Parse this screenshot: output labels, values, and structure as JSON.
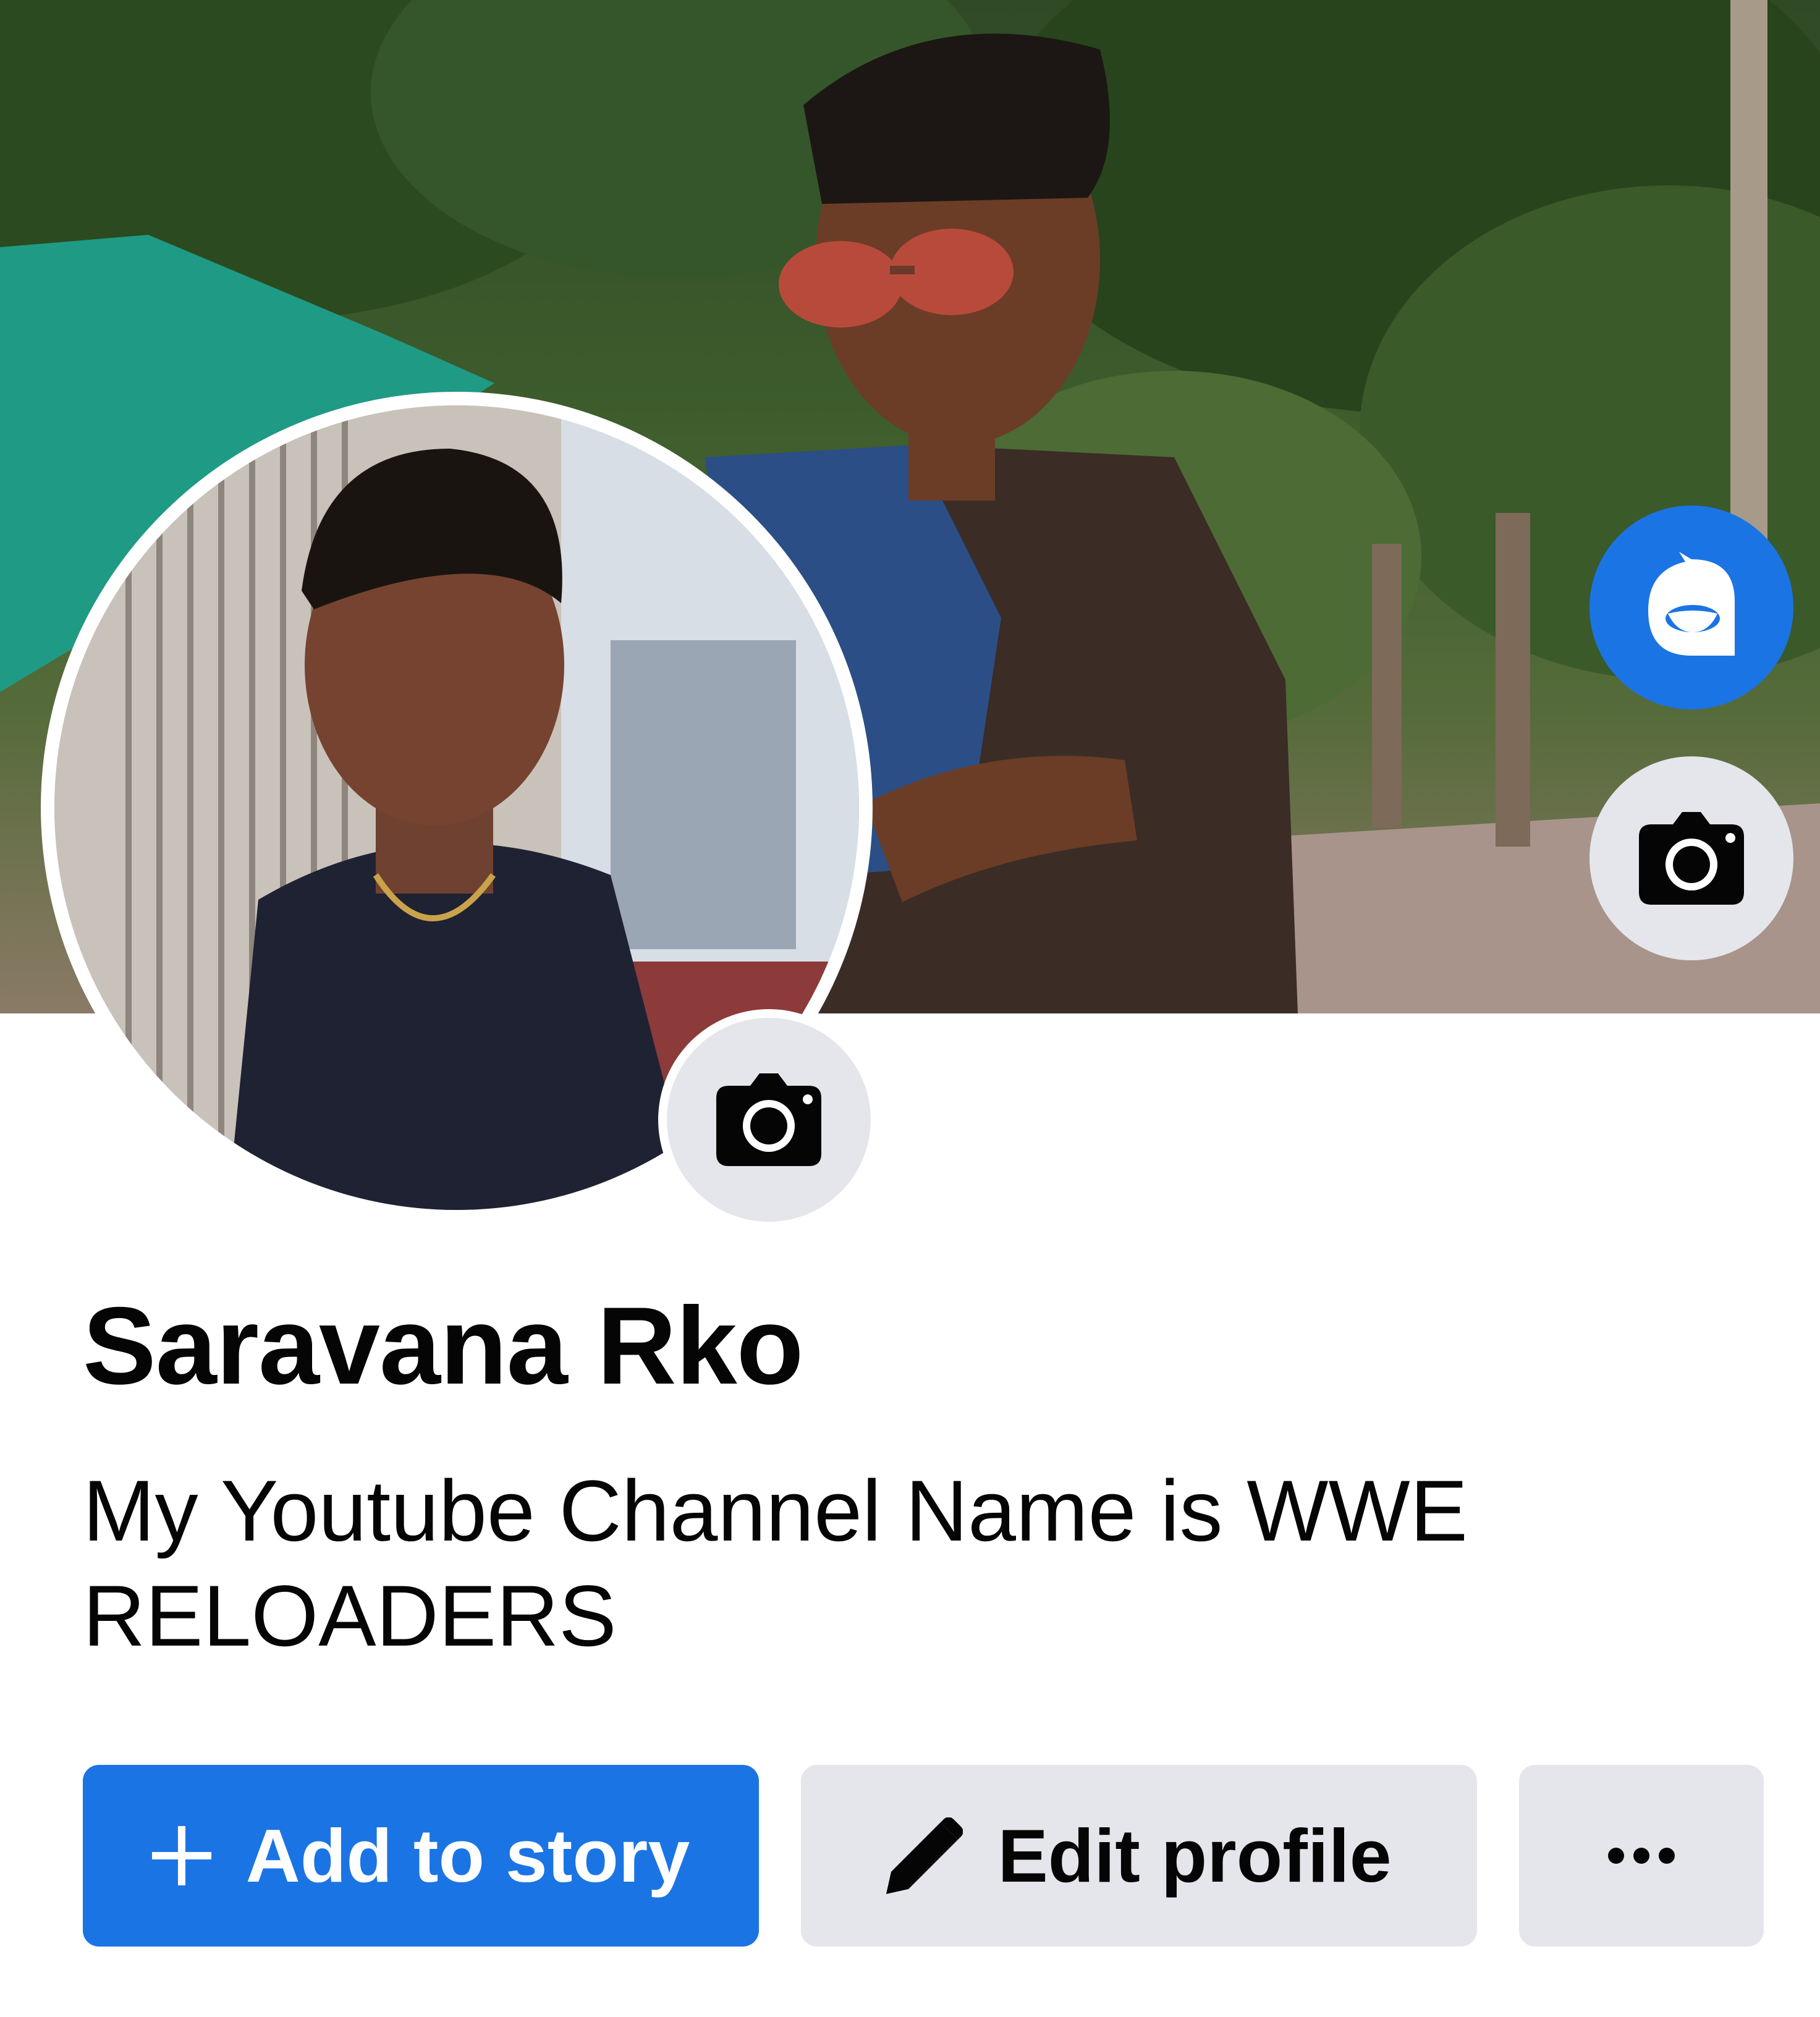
{
  "profile": {
    "name": "Saravana Rko",
    "bio": "My Youtube Channel Name is WWE RELOADERS"
  },
  "actions": {
    "add_story_label": "Add to story",
    "edit_profile_label": "Edit profile"
  },
  "icons": {
    "add_story": "plus-icon",
    "edit_profile": "pencil-icon",
    "more": "more-horizontal-icon",
    "cover_camera": "camera-icon",
    "avatar_camera": "camera-icon",
    "avatar_creator": "avatar-icon"
  },
  "colors": {
    "primary": "#1b74e4",
    "secondary_bg": "#e4e6eb",
    "text": "#050505"
  }
}
